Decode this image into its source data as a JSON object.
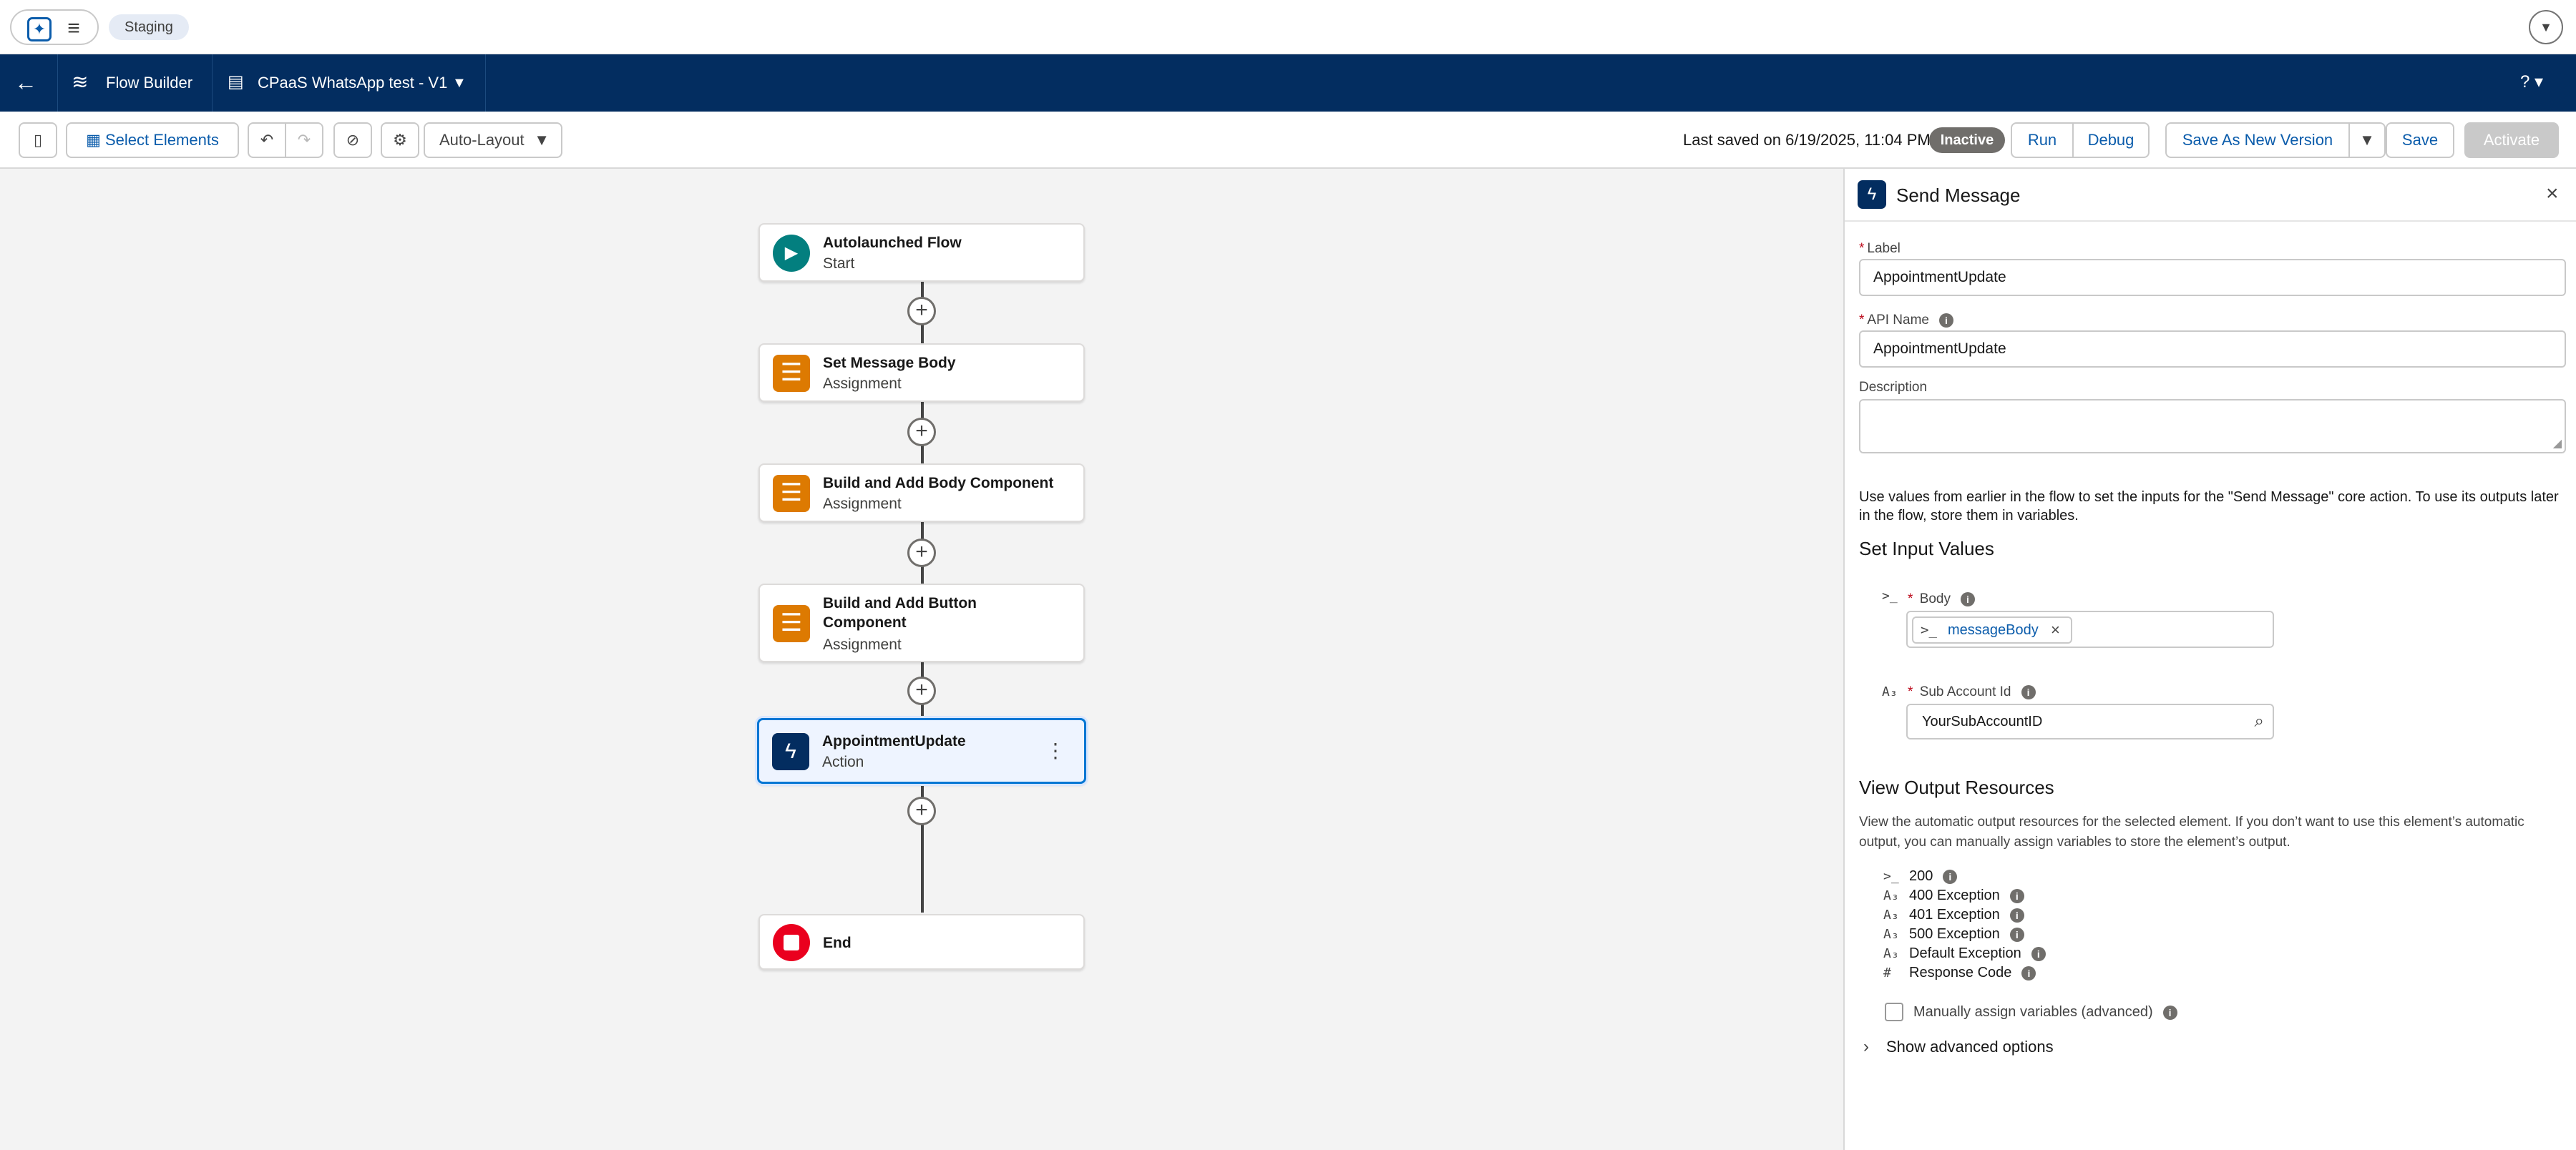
{
  "top_bar": {
    "environment_badge": "Staging",
    "icons": {
      "app": "app-launcher-icon",
      "menu": "hamburger-menu-icon",
      "user": "chevron-down-icon"
    }
  },
  "nav": {
    "app_name": "Flow Builder",
    "flow_name": "CPaaS WhatsApp test - V1",
    "help": "? ▾"
  },
  "toolbar": {
    "select_elements": "Select Elements",
    "layout_option": "Auto-Layout",
    "save_status": "Last saved on 6/19/2025, 11:04 PM",
    "status_badge": "Inactive",
    "run": "Run",
    "debug": "Debug",
    "save_new_version": "Save As New Version",
    "save": "Save",
    "activate": "Activate"
  },
  "canvas": {
    "nodes": [
      {
        "title": "Autolaunched Flow",
        "subtitle": "Start",
        "kind": "start"
      },
      {
        "title": "Set Message Body",
        "subtitle": "Assignment",
        "kind": "assignment"
      },
      {
        "title": "Build and Add Body Component",
        "subtitle": "Assignment",
        "kind": "assignment"
      },
      {
        "title": "Build and Add Button Component",
        "subtitle": "Assignment",
        "kind": "assignment"
      },
      {
        "title": "AppointmentUpdate",
        "subtitle": "Action",
        "kind": "action",
        "selected": true
      },
      {
        "title": "End",
        "subtitle": "",
        "kind": "end"
      }
    ]
  },
  "panel": {
    "title": "Send Message",
    "label_field": {
      "label": "Label",
      "value": "AppointmentUpdate"
    },
    "api_name_field": {
      "label": "API Name",
      "value": "AppointmentUpdate"
    },
    "description_field": {
      "label": "Description",
      "value": ""
    },
    "help_text": "Use values from earlier in the flow to set the inputs for the \"Send Message\" core action. To use its outputs later in the flow, store them in variables.",
    "input_title": "Set Input Values",
    "body_param": {
      "label": "Body",
      "resource": "messageBody"
    },
    "sub_account_param": {
      "label": "Sub Account Id",
      "value": "YourSubAccountID"
    },
    "output_title": "View Output Resources",
    "output_help": "View the automatic output resources for the selected element. If you don’t want to use this element’s automatic output, you can manually assign variables to store the element’s output.",
    "outputs": [
      "200",
      "400 Exception",
      "401 Exception",
      "500 Exception",
      "Default Exception",
      "Response Code"
    ],
    "manual_assign": "Manually assign variables (advanced)",
    "advanced": "Show advanced options"
  },
  "colors": {
    "navy": "#032d60",
    "blue": "#0176d3",
    "start": "#037f7f",
    "assignment": "#dd7a01",
    "end": "#ea001e",
    "inactive": "#706e6b"
  }
}
